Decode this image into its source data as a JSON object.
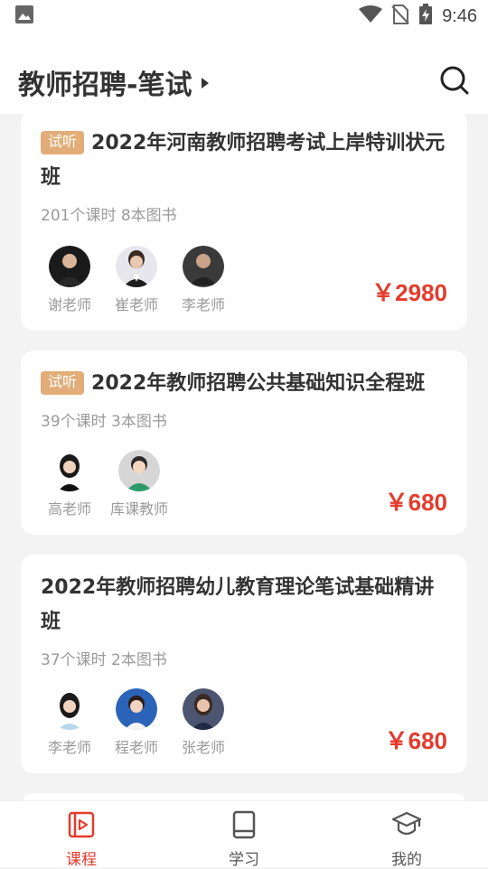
{
  "status_bar": {
    "time": "9:46"
  },
  "header": {
    "title": "教师招聘-笔试"
  },
  "courses": [
    {
      "badge": "试听",
      "title": "2022年河南教师招聘考试上岸特训状元班",
      "meta": "201个课时 8本图书",
      "teachers": [
        "谢老师",
        "崔老师",
        "李老师"
      ],
      "price": "￥2980"
    },
    {
      "badge": "试听",
      "title": "2022年教师招聘公共基础知识全程班",
      "meta": "39个课时 3本图书",
      "teachers": [
        "高老师",
        "库课教师"
      ],
      "price": "￥680"
    },
    {
      "badge": "",
      "title": "2022年教师招聘幼儿教育理论笔试基础精讲班",
      "meta": "37个课时 2本图书",
      "teachers": [
        "李老师",
        "程老师",
        "张老师"
      ],
      "price": "￥680"
    }
  ],
  "tabs": [
    {
      "label": "课程",
      "icon": "video-course-icon",
      "active": true
    },
    {
      "label": "学习",
      "icon": "book-icon",
      "active": false
    },
    {
      "label": "我的",
      "icon": "graduation-cap-icon",
      "active": false
    }
  ],
  "colors": {
    "accent": "#e53b2c",
    "badge": "#e2ad78"
  }
}
